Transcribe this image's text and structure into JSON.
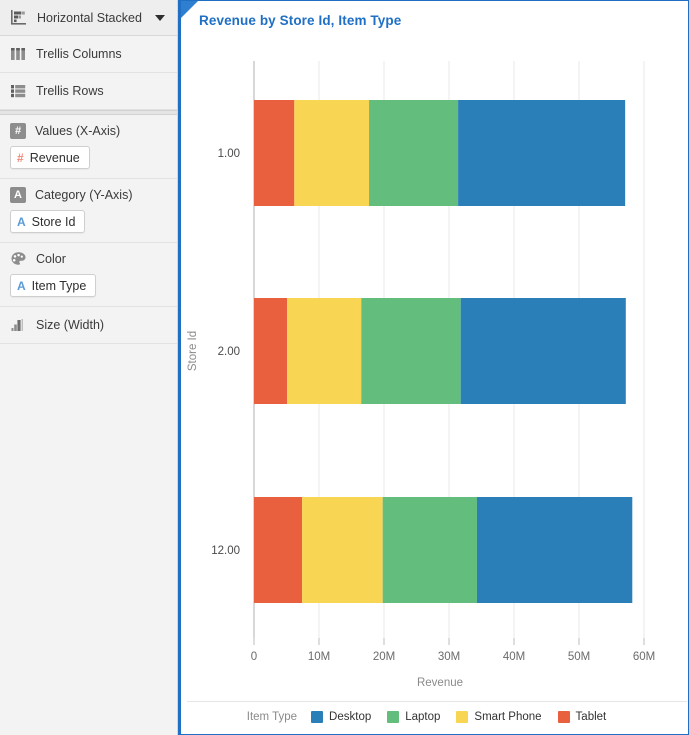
{
  "sidebar": {
    "chart_type": {
      "label": "Horizontal Stacked",
      "icon": "horizontal-stacked-icon",
      "caret": "chevron-down-icon"
    },
    "shelves": [
      {
        "label": "Trellis Columns",
        "icon": "trellis-columns-icon"
      },
      {
        "label": "Trellis Rows",
        "icon": "trellis-rows-icon"
      }
    ],
    "groups": [
      {
        "label": "Values (X-Axis)",
        "icon": "measure-icon",
        "glyph": "#",
        "pill": {
          "label": "Revenue",
          "glyph": "#",
          "glyph_color": "#f08a7a"
        }
      },
      {
        "label": "Category (Y-Axis)",
        "icon": "attribute-icon",
        "glyph": "A",
        "pill": {
          "label": "Store Id",
          "glyph": "A",
          "glyph_color": "#5b9bd5"
        }
      },
      {
        "label": "Color",
        "icon": "palette-icon",
        "glyph": "",
        "pill": {
          "label": "Item Type",
          "glyph": "A",
          "glyph_color": "#5b9bd5"
        }
      },
      {
        "label": "Size (Width)",
        "icon": "size-width-icon",
        "glyph": "",
        "pill": null
      }
    ]
  },
  "panel": {
    "title": "Revenue by Store Id, Item Type",
    "accent_color": "#1f6fc4"
  },
  "chart_data": {
    "type": "bar",
    "orientation": "horizontal",
    "stacked": true,
    "title": "Revenue by Store Id, Item Type",
    "xlabel": "Revenue",
    "ylabel": "Store Id",
    "legend_title": "Item Type",
    "legend_position": "bottom",
    "grid": true,
    "xlim": [
      0,
      62
    ],
    "xticks": [
      0,
      10,
      20,
      30,
      40,
      50,
      60
    ],
    "xticklabels": [
      "0",
      "10M",
      "20M",
      "30M",
      "40M",
      "50M",
      "60M"
    ],
    "unit": "millions",
    "categories": [
      "1.00",
      "2.00",
      "12.00"
    ],
    "series": [
      {
        "name": "Tablet",
        "color": "#e9603f",
        "values": [
          6.2,
          5.1,
          7.4
        ]
      },
      {
        "name": "Smart Phone",
        "color": "#f8d553",
        "values": [
          11.5,
          11.4,
          12.4
        ]
      },
      {
        "name": "Laptop",
        "color": "#63bd7d",
        "values": [
          13.7,
          15.3,
          14.5
        ]
      },
      {
        "name": "Desktop",
        "color": "#2b7fb8",
        "values": [
          25.7,
          25.4,
          23.9
        ]
      }
    ],
    "stack_order": [
      "Tablet",
      "Smart Phone",
      "Laptop",
      "Desktop"
    ],
    "legend_order": [
      "Desktop",
      "Laptop",
      "Smart Phone",
      "Tablet"
    ],
    "totals": [
      57.1,
      57.2,
      58.2
    ]
  }
}
